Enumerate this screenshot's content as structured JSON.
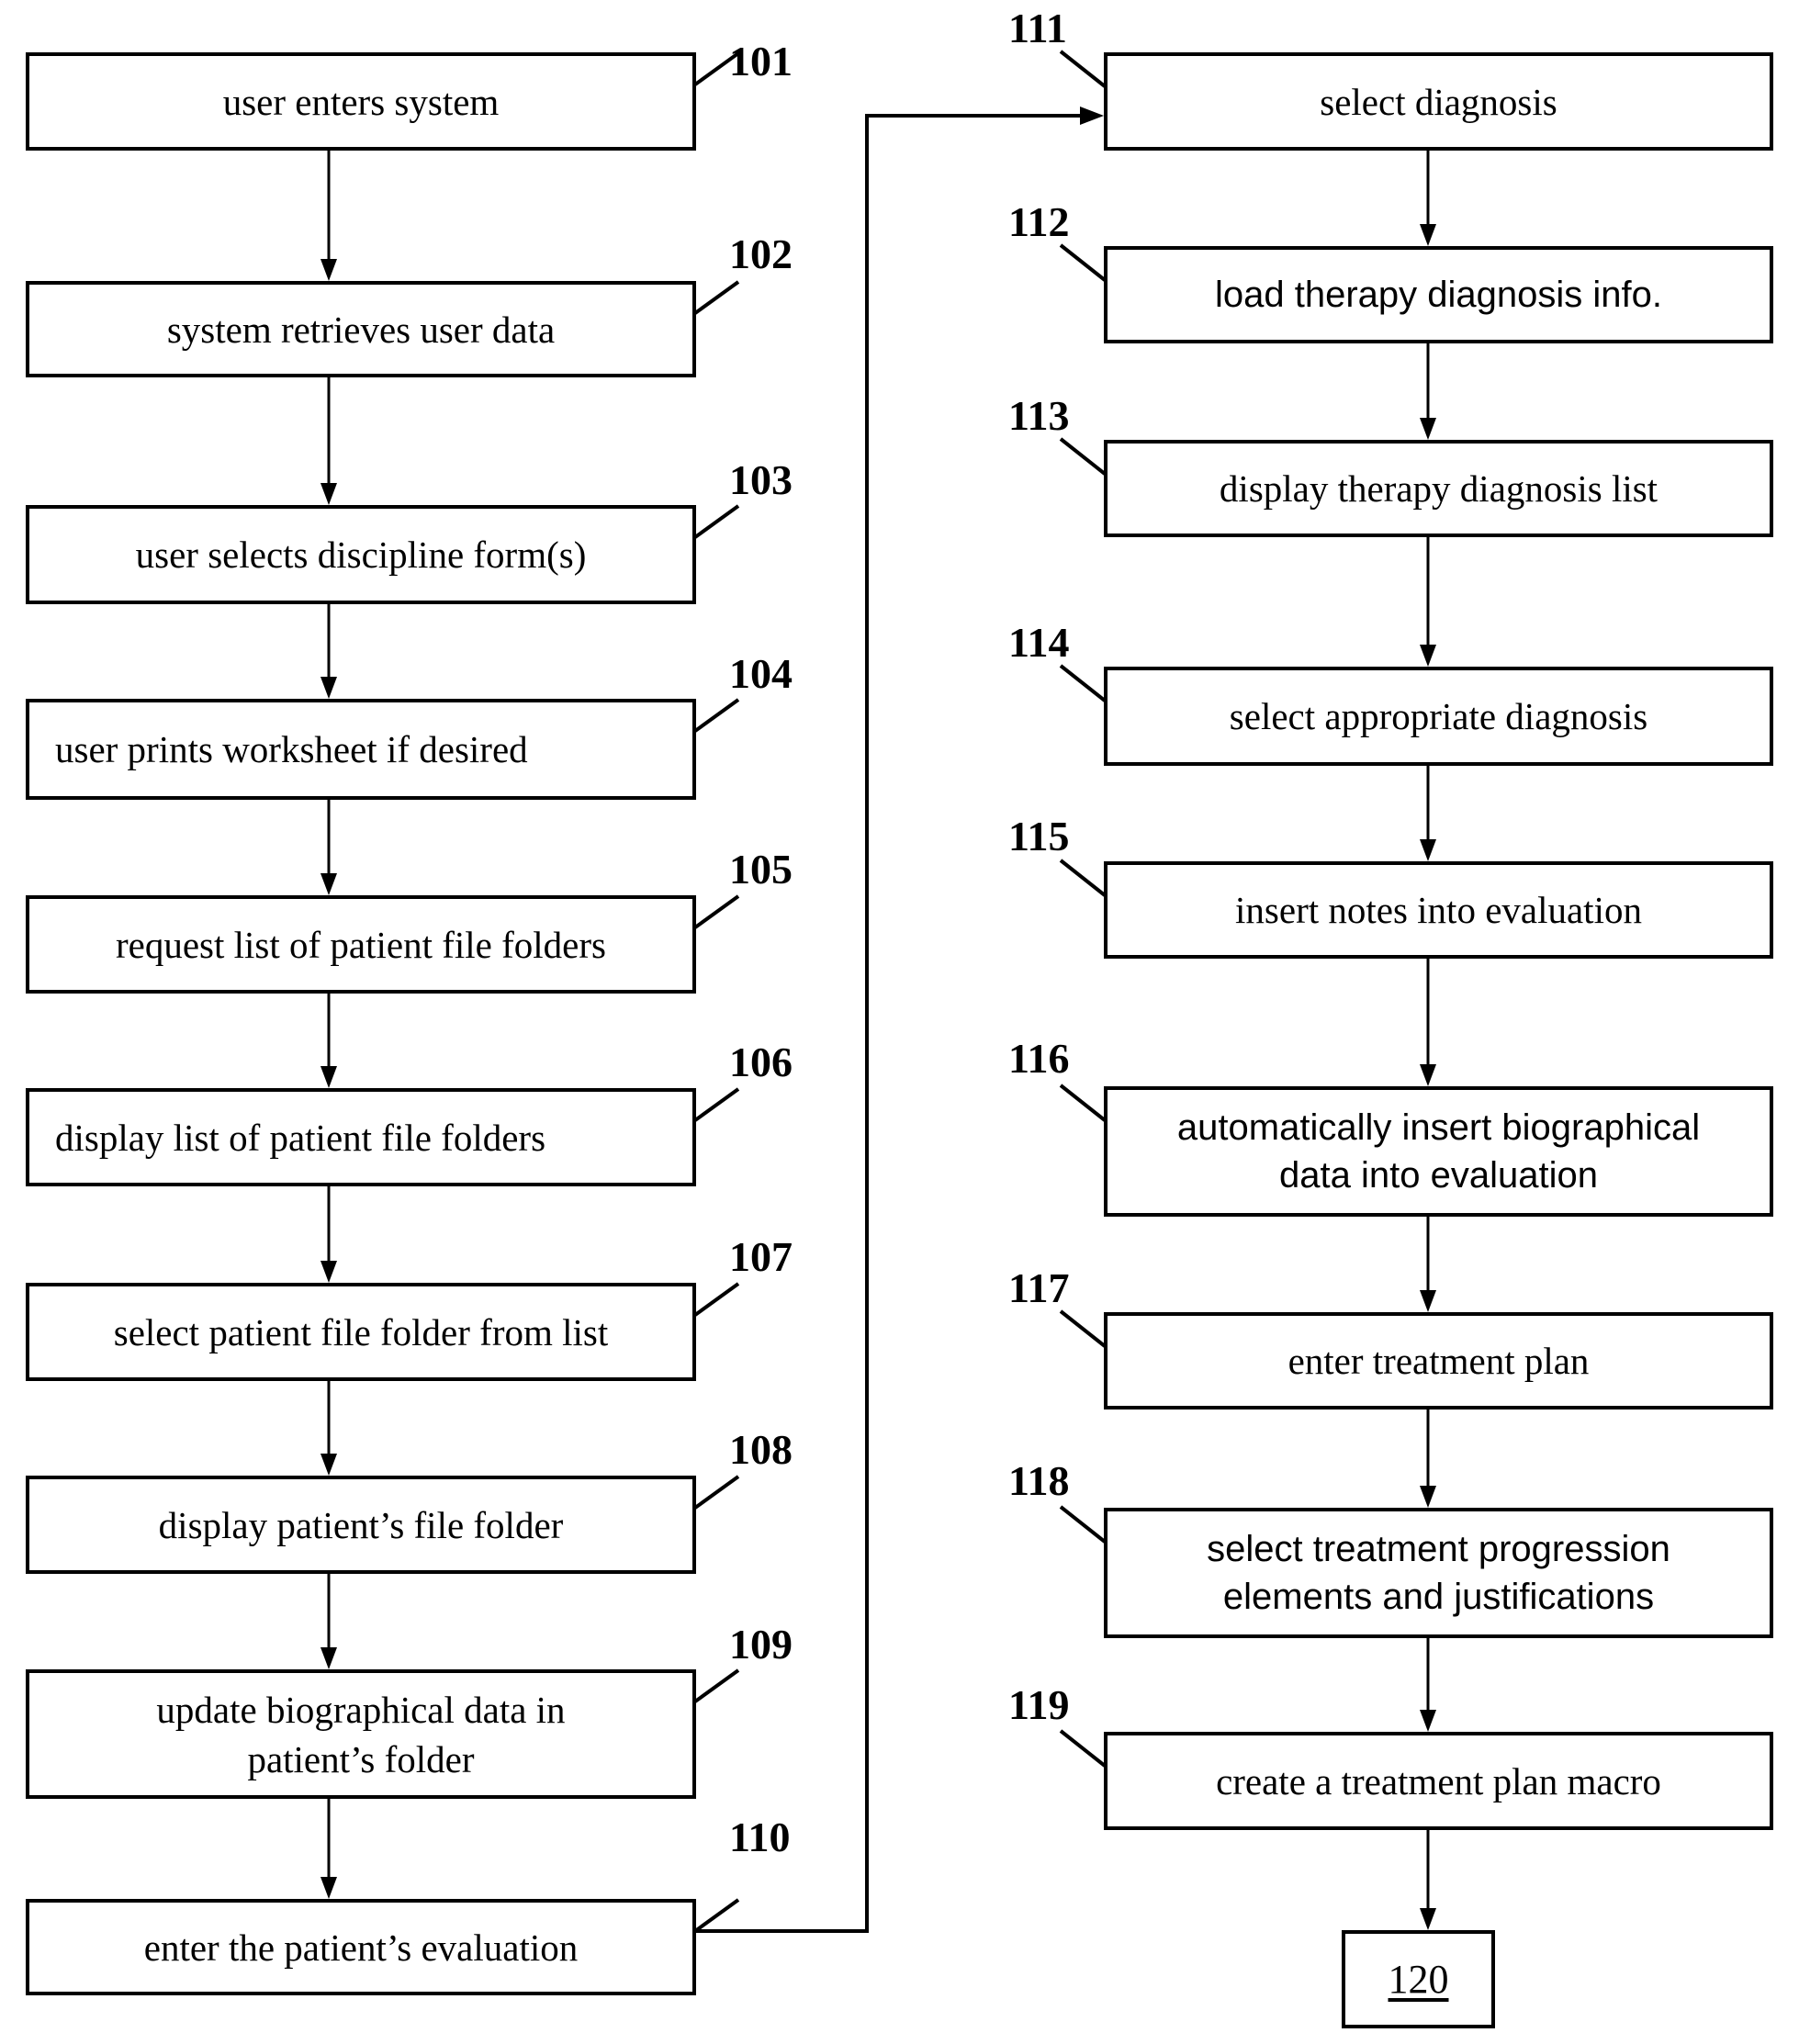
{
  "figure": {
    "steps": [
      {
        "ref": "101",
        "text": "user enters system",
        "next": "102"
      },
      {
        "ref": "102",
        "text": "system retrieves user data",
        "next": "103"
      },
      {
        "ref": "103",
        "text": "user selects discipline form(s)",
        "next": "104"
      },
      {
        "ref": "104",
        "text": "user prints worksheet if desired",
        "next": "105"
      },
      {
        "ref": "105",
        "text": "request list of patient file folders",
        "next": "106"
      },
      {
        "ref": "106",
        "text": "display list of patient file folders",
        "next": "107"
      },
      {
        "ref": "107",
        "text": "select patient file folder from list",
        "next": "108"
      },
      {
        "ref": "108",
        "text": "display patient’s file folder",
        "next": "109"
      },
      {
        "ref": "109",
        "text": "update biographical data in\npatient’s folder",
        "next": "110"
      },
      {
        "ref": "110",
        "text": "enter the patient’s evaluation",
        "next": "111"
      },
      {
        "ref": "111",
        "text": "select diagnosis",
        "next": "112"
      },
      {
        "ref": "112",
        "text": "load therapy diagnosis info.",
        "next": "113"
      },
      {
        "ref": "113",
        "text": "display therapy diagnosis list",
        "next": "114"
      },
      {
        "ref": "114",
        "text": "select appropriate diagnosis",
        "next": "115"
      },
      {
        "ref": "115",
        "text": "insert notes into evaluation",
        "next": "116"
      },
      {
        "ref": "116",
        "text": "automatically insert biographical\ndata into evaluation",
        "next": "117"
      },
      {
        "ref": "117",
        "text": "enter treatment plan",
        "next": "118"
      },
      {
        "ref": "118",
        "text": "select treatment progression\nelements and justifications",
        "next": "119"
      },
      {
        "ref": "119",
        "text": "create a treatment plan macro",
        "next": "120"
      }
    ],
    "terminal": {
      "ref": "120",
      "text": "120"
    }
  }
}
